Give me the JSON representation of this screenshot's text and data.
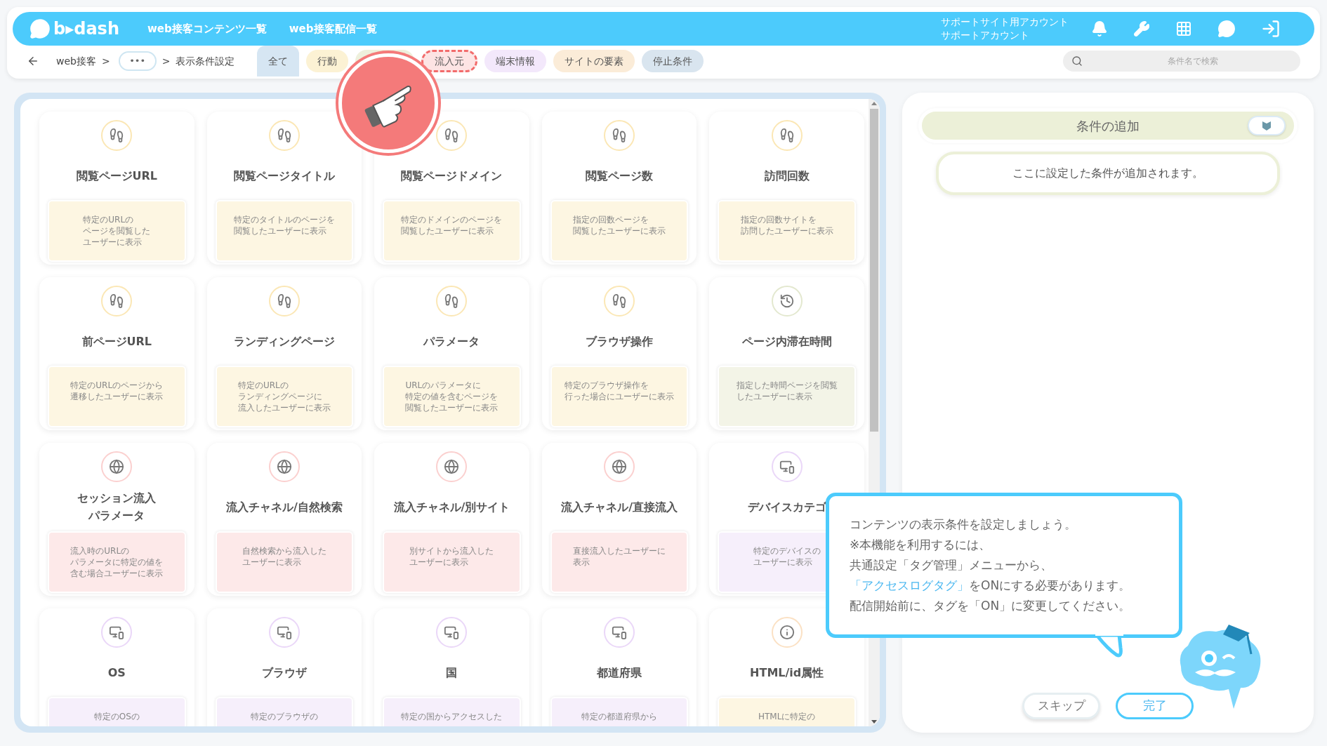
{
  "header": {
    "logo": "b▸dash",
    "nav": [
      "web接客コンテンツ一覧",
      "web接客配信一覧"
    ],
    "account": [
      "サポートサイト用アカウント",
      "サポートアカウント"
    ]
  },
  "breadcrumb": {
    "items": [
      "web接客",
      "表示条件設定"
    ],
    "separator": ">",
    "more": "•••"
  },
  "tabs": [
    {
      "label": "全て",
      "selected": true,
      "color": "#d6e6f3"
    },
    {
      "label": "行動",
      "selected": false,
      "color": "#fcf2d4"
    },
    {
      "selected": false,
      "color": "#eef0dc"
    },
    {
      "label": "流入元",
      "selected": false,
      "color": "#fde4e4",
      "highlighted": true
    },
    {
      "label": "端末情報",
      "selected": false,
      "color": "#f3e8fb"
    },
    {
      "label": "サイトの要素",
      "selected": false,
      "color": "#fbecd8"
    },
    {
      "label": "停止条件",
      "selected": false,
      "color": "#d9e5ef"
    }
  ],
  "search": {
    "placeholder": "条件名で検索"
  },
  "cards": [
    {
      "kind": "footprints",
      "title": [
        "閲覧ページURL"
      ],
      "description": [
        "特定のURLの",
        "ページを閲覧した",
        "ユーザーに表示"
      ],
      "color": "#fdf6e2"
    },
    {
      "kind": "footprints",
      "title": [
        "閲覧ページタイトル"
      ],
      "description": [
        "特定のタイトルのページを",
        "閲覧したユーザーに表示"
      ],
      "color": "#fdf6e2"
    },
    {
      "kind": "footprints",
      "title": [
        "閲覧ページドメイン"
      ],
      "description": [
        "特定のドメインのページを",
        "閲覧したユーザーに表示"
      ],
      "color": "#fdf6e2"
    },
    {
      "kind": "footprints",
      "title": [
        "閲覧ページ数"
      ],
      "description": [
        "指定の回数ページを",
        "閲覧したユーザーに表示"
      ],
      "color": "#fdf6e2"
    },
    {
      "kind": "footprints",
      "title": [
        "訪問回数"
      ],
      "description": [
        "指定の回数サイトを",
        "訪問したユーザーに表示"
      ],
      "color": "#fdf6e2"
    },
    {
      "kind": "footprints",
      "title": [
        "前ページURL"
      ],
      "description": [
        "特定のURLのページから",
        "遷移したユーザーに表示"
      ],
      "color": "#fdf6e2"
    },
    {
      "kind": "footprints",
      "title": [
        "ランディングページ"
      ],
      "description": [
        "特定のURLの",
        "ランディングページに",
        "流入したユーザーに表示"
      ],
      "color": "#fdf6e2"
    },
    {
      "kind": "footprints",
      "title": [
        "パラメータ"
      ],
      "description": [
        "URLのパラメータに",
        "特定の値を含むページを",
        "閲覧したユーザーに表示"
      ],
      "color": "#fdf6e2"
    },
    {
      "kind": "footprints",
      "title": [
        "ブラウザ操作"
      ],
      "description": [
        "特定のブラウザ操作を",
        "行った場合にユーザーに表示"
      ],
      "color": "#fdf6e2"
    },
    {
      "kind": "clock",
      "title": [
        "ページ内滞在時間"
      ],
      "description": [
        "指定した時間ページを閲覧",
        "したユーザーに表示"
      ],
      "color": "#f3f4e7"
    },
    {
      "kind": "globe",
      "title": [
        "セッション流入",
        "パラメータ"
      ],
      "description": [
        "流入時のURLの",
        "パラメータに特定の値を",
        "含む場合ユーザーに表示"
      ],
      "color": "#fde9e9"
    },
    {
      "kind": "globe",
      "title": [
        "流入チャネル/自然検索"
      ],
      "description": [
        "自然検索から流入した",
        "ユーザーに表示"
      ],
      "color": "#fde9e9"
    },
    {
      "kind": "globe",
      "title": [
        "流入チャネル/別サイト"
      ],
      "description": [
        "別サイトから流入した",
        "ユーザーに表示"
      ],
      "color": "#fde9e9"
    },
    {
      "kind": "globe",
      "title": [
        "流入チャネル/直接流入"
      ],
      "description": [
        "直接流入したユーザーに",
        "表示"
      ],
      "color": "#fde9e9"
    },
    {
      "kind": "device",
      "title": [
        "デバイスカテゴ"
      ],
      "description": [
        "特定のデバイスの",
        "ユーザーに表示"
      ],
      "color": "#f6effb"
    },
    {
      "kind": "device",
      "title": [
        "OS"
      ],
      "description": [
        "特定のOSの"
      ],
      "color": "#f6effb"
    },
    {
      "kind": "device",
      "title": [
        "ブラウザ"
      ],
      "description": [
        "特定のブラウザの"
      ],
      "color": "#f6effb"
    },
    {
      "kind": "device",
      "title": [
        "国"
      ],
      "description": [
        "特定の国からアクセスした"
      ],
      "color": "#f6effb"
    },
    {
      "kind": "device",
      "title": [
        "都道府県"
      ],
      "description": [
        "特定の都道府県から"
      ],
      "color": "#f6effb"
    },
    {
      "kind": "info",
      "title": [
        "HTML/id属性"
      ],
      "description": [
        "HTMLに特定の"
      ],
      "color": "#fdf6e2"
    }
  ],
  "panel": {
    "title": "条件の追加",
    "empty": "ここに設定した条件が追加されます。"
  },
  "tooltip": {
    "lines": [
      {
        "text": "コンテンツの表示条件を設定しましょう。"
      },
      {
        "text": "※本機能を利用するには、"
      },
      {
        "text": "共通設定「タグ管理」メニューから、"
      },
      {
        "link": "「アクセスログタグ」",
        "text": "をONにする必要があります。"
      },
      {
        "text": "配信開始前に、タグを「ON」に変更してください。"
      }
    ]
  },
  "buttons": [
    {
      "label": "スキップ",
      "kind": "secondary"
    },
    {
      "label": "完了",
      "kind": "primary"
    }
  ]
}
